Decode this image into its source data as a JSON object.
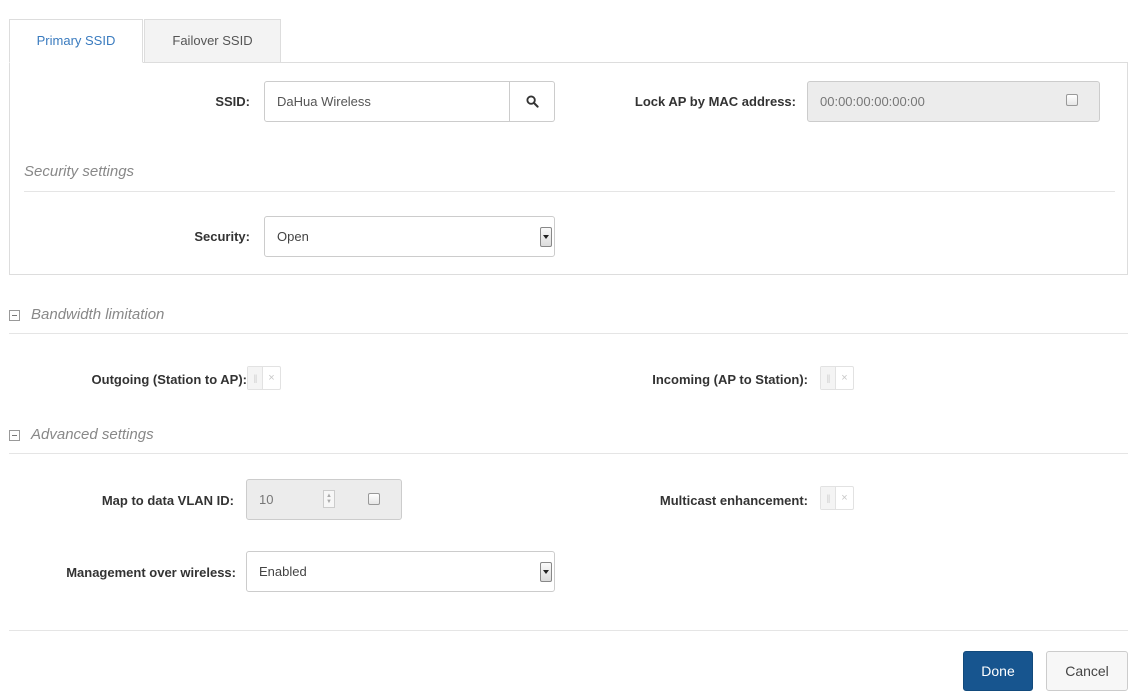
{
  "tabs": [
    {
      "label": "Primary SSID",
      "active": true
    },
    {
      "label": "Failover SSID",
      "active": false
    }
  ],
  "ssid": {
    "label": "SSID:",
    "value": "DaHua Wireless",
    "search_icon": "search-icon"
  },
  "lock_ap": {
    "label": "Lock AP by MAC address:",
    "value": "00:00:00:00:00:00",
    "checked": false
  },
  "security_settings": {
    "title": "Security settings",
    "security_label": "Security:",
    "security_value": "Open"
  },
  "bandwidth": {
    "title": "Bandwidth limitation",
    "outgoing_label": "Outgoing (Station to AP):",
    "incoming_label": "Incoming (AP to Station):"
  },
  "advanced": {
    "title": "Advanced settings",
    "vlan_label": "Map to data VLAN ID:",
    "vlan_value": "10",
    "multicast_label": "Multicast enhancement:",
    "management_label": "Management over wireless:",
    "management_value": "Enabled"
  },
  "toggle_glyphs": {
    "knob": "||",
    "off": "×"
  },
  "footer": {
    "done_label": "Done",
    "cancel_label": "Cancel"
  },
  "colors": {
    "tab_active_text": "#3a7bbf",
    "primary_button": "#17558f"
  }
}
